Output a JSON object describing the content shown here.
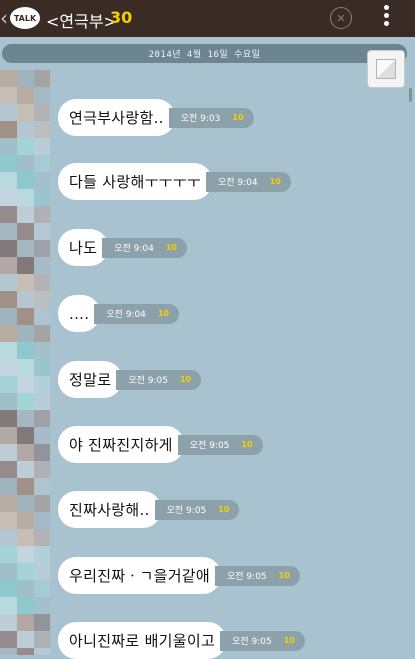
{
  "header": {
    "logo_text": "TALK",
    "title": "<연극부>",
    "member_count": "30"
  },
  "date_divider": "2014년 4월 16일 수요일",
  "messages": [
    {
      "text": "연극부사랑함..",
      "time": "오전 9:03",
      "unread": "10"
    },
    {
      "text": "다들 사랑해ㅜㅜㅜㅜ",
      "time": "오전 9:04",
      "unread": "10"
    },
    {
      "text": "나도",
      "time": "오전 9:04",
      "unread": "10"
    },
    {
      "text": "....",
      "time": "오전 9:04",
      "unread": "10"
    },
    {
      "text": "정말로",
      "time": "오전 9:05",
      "unread": "10"
    },
    {
      "text": "야 진짜진지하게",
      "time": "오전 9:05",
      "unread": "10"
    },
    {
      "text": "진짜사랑해..",
      "time": "오전 9:05",
      "unread": "10"
    },
    {
      "text": "우리진짜ㆍㄱ을거같애",
      "time": "오전 9:05",
      "unread": "10"
    },
    {
      "text": "아니진짜로 배기울이고",
      "time": "오전 9:05",
      "unread": "10"
    }
  ],
  "colors": {
    "header_bg": "#3a2b25",
    "chat_bg": "#a9c2d0",
    "unread_count": "#f5d000"
  }
}
